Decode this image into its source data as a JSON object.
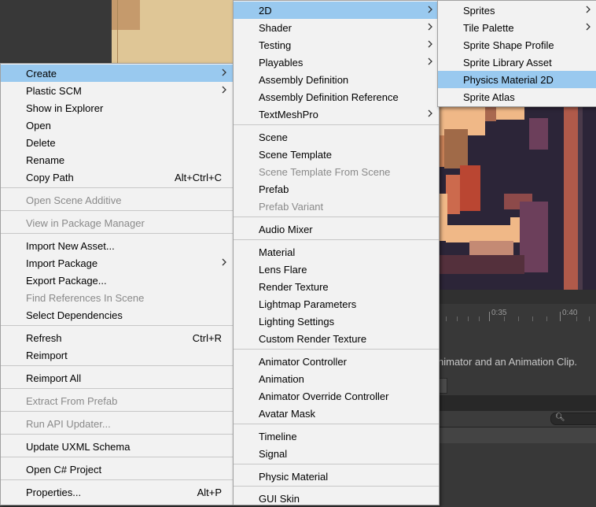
{
  "background": {
    "scene_info_text": "nimator and an Animation Clip.",
    "ruler_labels": [
      "0:35",
      "0:40"
    ]
  },
  "context_menu": {
    "items": [
      {
        "label": "Create",
        "shortcut": "",
        "submenu": true,
        "highlight": true,
        "disabled": false
      },
      {
        "label": "Plastic SCM",
        "shortcut": "",
        "submenu": true,
        "highlight": false,
        "disabled": false
      },
      {
        "label": "Show in Explorer",
        "shortcut": "",
        "submenu": false,
        "highlight": false,
        "disabled": false
      },
      {
        "label": "Open",
        "shortcut": "",
        "submenu": false,
        "highlight": false,
        "disabled": false
      },
      {
        "label": "Delete",
        "shortcut": "",
        "submenu": false,
        "highlight": false,
        "disabled": false
      },
      {
        "label": "Rename",
        "shortcut": "",
        "submenu": false,
        "highlight": false,
        "disabled": false
      },
      {
        "label": "Copy Path",
        "shortcut": "Alt+Ctrl+C",
        "submenu": false,
        "highlight": false,
        "disabled": false
      },
      {
        "label": "Open Scene Additive",
        "shortcut": "",
        "submenu": false,
        "highlight": false,
        "disabled": true
      },
      {
        "label": "View in Package Manager",
        "shortcut": "",
        "submenu": false,
        "highlight": false,
        "disabled": true
      },
      {
        "label": "Import New Asset...",
        "shortcut": "",
        "submenu": false,
        "highlight": false,
        "disabled": false
      },
      {
        "label": "Import Package",
        "shortcut": "",
        "submenu": true,
        "highlight": false,
        "disabled": false
      },
      {
        "label": "Export Package...",
        "shortcut": "",
        "submenu": false,
        "highlight": false,
        "disabled": false
      },
      {
        "label": "Find References In Scene",
        "shortcut": "",
        "submenu": false,
        "highlight": false,
        "disabled": true
      },
      {
        "label": "Select Dependencies",
        "shortcut": "",
        "submenu": false,
        "highlight": false,
        "disabled": false
      },
      {
        "label": "Refresh",
        "shortcut": "Ctrl+R",
        "submenu": false,
        "highlight": false,
        "disabled": false
      },
      {
        "label": "Reimport",
        "shortcut": "",
        "submenu": false,
        "highlight": false,
        "disabled": false
      },
      {
        "label": "Reimport All",
        "shortcut": "",
        "submenu": false,
        "highlight": false,
        "disabled": false
      },
      {
        "label": "Extract From Prefab",
        "shortcut": "",
        "submenu": false,
        "highlight": false,
        "disabled": true
      },
      {
        "label": "Run API Updater...",
        "shortcut": "",
        "submenu": false,
        "highlight": false,
        "disabled": true
      },
      {
        "label": "Update UXML Schema",
        "shortcut": "",
        "submenu": false,
        "highlight": false,
        "disabled": false
      },
      {
        "label": "Open C# Project",
        "shortcut": "",
        "submenu": false,
        "highlight": false,
        "disabled": false
      },
      {
        "label": "Properties...",
        "shortcut": "Alt+P",
        "submenu": false,
        "highlight": false,
        "disabled": false
      }
    ]
  },
  "create_menu": {
    "items": [
      {
        "label": "2D",
        "submenu": true,
        "highlight": true,
        "disabled": false
      },
      {
        "label": "Shader",
        "submenu": true,
        "highlight": false,
        "disabled": false
      },
      {
        "label": "Testing",
        "submenu": true,
        "highlight": false,
        "disabled": false
      },
      {
        "label": "Playables",
        "submenu": true,
        "highlight": false,
        "disabled": false
      },
      {
        "label": "Assembly Definition",
        "submenu": false,
        "highlight": false,
        "disabled": false
      },
      {
        "label": "Assembly Definition Reference",
        "submenu": false,
        "highlight": false,
        "disabled": false
      },
      {
        "label": "TextMeshPro",
        "submenu": true,
        "highlight": false,
        "disabled": false
      },
      {
        "label": "Scene",
        "submenu": false,
        "highlight": false,
        "disabled": false
      },
      {
        "label": "Scene Template",
        "submenu": false,
        "highlight": false,
        "disabled": false
      },
      {
        "label": "Scene Template From Scene",
        "submenu": false,
        "highlight": false,
        "disabled": true
      },
      {
        "label": "Prefab",
        "submenu": false,
        "highlight": false,
        "disabled": false
      },
      {
        "label": "Prefab Variant",
        "submenu": false,
        "highlight": false,
        "disabled": true
      },
      {
        "label": "Audio Mixer",
        "submenu": false,
        "highlight": false,
        "disabled": false
      },
      {
        "label": "Material",
        "submenu": false,
        "highlight": false,
        "disabled": false
      },
      {
        "label": "Lens Flare",
        "submenu": false,
        "highlight": false,
        "disabled": false
      },
      {
        "label": "Render Texture",
        "submenu": false,
        "highlight": false,
        "disabled": false
      },
      {
        "label": "Lightmap Parameters",
        "submenu": false,
        "highlight": false,
        "disabled": false
      },
      {
        "label": "Lighting Settings",
        "submenu": false,
        "highlight": false,
        "disabled": false
      },
      {
        "label": "Custom Render Texture",
        "submenu": false,
        "highlight": false,
        "disabled": false
      },
      {
        "label": "Animator Controller",
        "submenu": false,
        "highlight": false,
        "disabled": false
      },
      {
        "label": "Animation",
        "submenu": false,
        "highlight": false,
        "disabled": false
      },
      {
        "label": "Animator Override Controller",
        "submenu": false,
        "highlight": false,
        "disabled": false
      },
      {
        "label": "Avatar Mask",
        "submenu": false,
        "highlight": false,
        "disabled": false
      },
      {
        "label": "Timeline",
        "submenu": false,
        "highlight": false,
        "disabled": false
      },
      {
        "label": "Signal",
        "submenu": false,
        "highlight": false,
        "disabled": false
      },
      {
        "label": "Physic Material",
        "submenu": false,
        "highlight": false,
        "disabled": false
      },
      {
        "label": "GUI Skin",
        "submenu": false,
        "highlight": false,
        "disabled": false
      }
    ]
  },
  "submenu_2d": {
    "items": [
      {
        "label": "Sprites",
        "submenu": true,
        "highlight": false,
        "disabled": false
      },
      {
        "label": "Tile Palette",
        "submenu": true,
        "highlight": false,
        "disabled": false
      },
      {
        "label": "Sprite Shape Profile",
        "submenu": false,
        "highlight": false,
        "disabled": false
      },
      {
        "label": "Sprite Library Asset",
        "submenu": false,
        "highlight": false,
        "disabled": false
      },
      {
        "label": "Physics Material 2D",
        "submenu": false,
        "highlight": true,
        "disabled": false
      },
      {
        "label": "Sprite Atlas",
        "submenu": false,
        "highlight": false,
        "disabled": false
      }
    ]
  },
  "colors": {
    "menu_bg": "#f2f2f2",
    "highlight": "#99c9ef",
    "disabled_text": "#8a8a8a",
    "editor_bg": "#383838"
  }
}
